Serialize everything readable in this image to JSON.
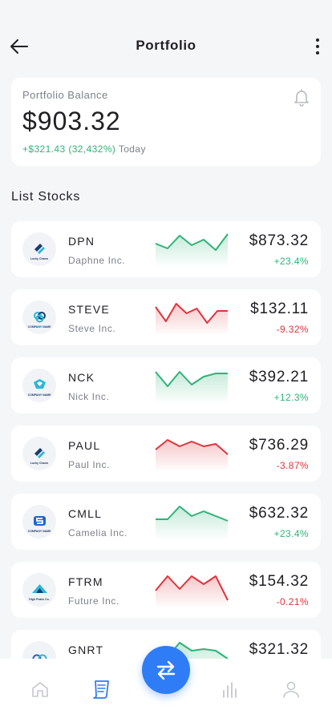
{
  "header": {
    "title": "Portfolio",
    "back_icon": "arrow-left-icon",
    "menu_icon": "more-vertical-icon"
  },
  "balance": {
    "label": "Portfolio Balance",
    "value": "$903.32",
    "change": "+$321.43 (32,432%)",
    "period": "Today",
    "icon": "bell-icon"
  },
  "section_title": "List Stocks",
  "colors": {
    "up": "#2fb378",
    "down": "#e0343c",
    "accent": "#2f7df6",
    "logo_navy": "#1c3c6e",
    "logo_teal": "#2bb7d8"
  },
  "stocks": [
    {
      "ticker": "DPN",
      "company": "Daphne Inc.",
      "price": "$873.32",
      "change": "+23.4%",
      "trend": "up",
      "logo_caption": "Lucky Charm",
      "spark": [
        14,
        20,
        4,
        16,
        9,
        22,
        2
      ]
    },
    {
      "ticker": "STEVE",
      "company": "Steve Inc.",
      "price": "$132.11",
      "change": "-9.32%",
      "trend": "down",
      "logo_caption": "COMPANY NAME",
      "spark": [
        8,
        26,
        4,
        16,
        10,
        28,
        13,
        13
      ]
    },
    {
      "ticker": "NCK",
      "company": "Nick Inc.",
      "price": "$392.21",
      "change": "+12.3%",
      "trend": "up",
      "logo_caption": "COMPANY NAME",
      "spark": [
        4,
        22,
        4,
        20,
        10,
        6,
        6
      ]
    },
    {
      "ticker": "PAUL",
      "company": "Paul Inc.",
      "price": "$736.29",
      "change": "-3.87%",
      "trend": "down",
      "logo_caption": "Lucky Charm",
      "spark": [
        16,
        4,
        12,
        6,
        12,
        9,
        22
      ]
    },
    {
      "ticker": "CMLL",
      "company": "Camelia Inc.",
      "price": "$632.32",
      "change": "+23.4%",
      "trend": "up",
      "logo_caption": "COMPANY NAME",
      "spark": [
        18,
        18,
        2,
        14,
        8,
        14,
        20
      ]
    },
    {
      "ticker": "FTRM",
      "company": "Future Inc.",
      "price": "$154.32",
      "change": "-0.21%",
      "trend": "down",
      "logo_caption": "High Peaks Co.",
      "spark": [
        22,
        4,
        20,
        4,
        14,
        4,
        34
      ]
    },
    {
      "ticker": "GNRT",
      "company": "",
      "price": "$321.32",
      "change": "",
      "trend": "up",
      "logo_caption": "",
      "spark": [
        24,
        20,
        2,
        12,
        10,
        12,
        22
      ]
    }
  ],
  "nav": [
    {
      "name": "home",
      "icon": "home-icon"
    },
    {
      "name": "portfolio",
      "icon": "document-icon",
      "active": true
    },
    {
      "name": "transfer",
      "icon": "swap-arrows-icon"
    },
    {
      "name": "stats",
      "icon": "bar-chart-icon"
    },
    {
      "name": "profile",
      "icon": "user-icon"
    }
  ]
}
